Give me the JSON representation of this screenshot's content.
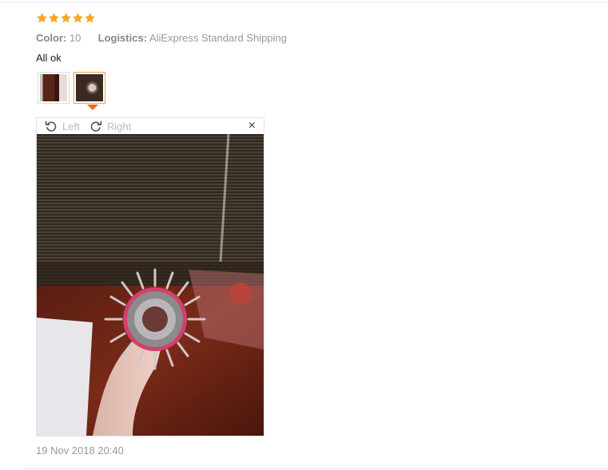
{
  "review": {
    "rating": 5,
    "star_color": "#f5a623",
    "color_label": "Color:",
    "color_value": "10",
    "logistics_label": "Logistics:",
    "logistics_value": "AliExpress Standard Shipping",
    "comment": "All ok",
    "date": "19 Nov 2018 20:40"
  },
  "thumbnails": [
    {
      "icon": "review-photo-1"
    },
    {
      "icon": "review-photo-2",
      "selected": true
    }
  ],
  "viewer": {
    "rotate_left_label": "Left",
    "rotate_right_label": "Right",
    "close_label": "×",
    "selected_accent": "#f06a1c",
    "photo_icon": "hairbrush-photo"
  }
}
